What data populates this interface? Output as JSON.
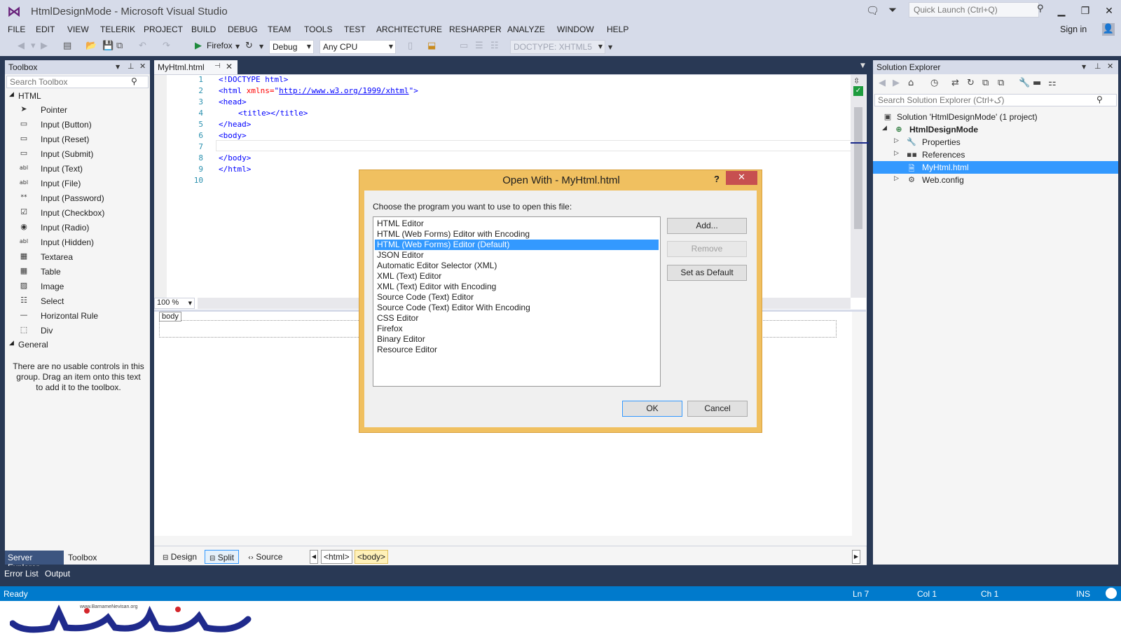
{
  "window": {
    "title": "HtmlDesignMode - Microsoft Visual Studio",
    "quick_launch_placeholder": "Quick Launch (Ctrl+Q)",
    "sign_in": "Sign in"
  },
  "menu": [
    "FILE",
    "EDIT",
    "VIEW",
    "TELERIK",
    "PROJECT",
    "BUILD",
    "DEBUG",
    "TEAM",
    "TOOLS",
    "TEST",
    "ARCHITECTURE",
    "RESHARPER",
    "ANALYZE",
    "WINDOW",
    "HELP"
  ],
  "toolbar": {
    "run_target": "Firefox",
    "configuration": "Debug",
    "platform": "Any CPU",
    "doctype": "DOCTYPE: XHTML5"
  },
  "toolbox": {
    "title": "Toolbox",
    "search_placeholder": "Search Toolbox",
    "group_html": "HTML",
    "items": [
      "Pointer",
      "Input (Button)",
      "Input (Reset)",
      "Input (Submit)",
      "Input (Text)",
      "Input (File)",
      "Input (Password)",
      "Input (Checkbox)",
      "Input (Radio)",
      "Input (Hidden)",
      "Textarea",
      "Table",
      "Image",
      "Select",
      "Horizontal Rule",
      "Div"
    ],
    "item_icons": [
      "pointer-icon",
      "button-icon",
      "reset-icon",
      "submit-icon",
      "textbox-icon",
      "file-icon",
      "password-icon",
      "checkbox-icon",
      "radio-icon",
      "hidden-icon",
      "textarea-icon",
      "table-icon",
      "image-icon",
      "select-icon",
      "horizontal-rule-icon",
      "div-icon"
    ],
    "group_general": "General",
    "general_empty": "There are no usable controls in this group. Drag an item onto this text to add it to the toolbox.",
    "tab_server_explorer": "Server Explorer",
    "tab_toolbox": "Toolbox"
  },
  "editor": {
    "tab_label": "MyHtml.html",
    "line_numbers": [
      "1",
      "2",
      "3",
      "4",
      "5",
      "6",
      "7",
      "8",
      "9",
      "10"
    ],
    "code": {
      "l1": "<!DOCTYPE html>",
      "l2_open": "<html ",
      "l2_attr": "xmlns=",
      "l2_q1": "\"",
      "l2_url": "http://www.w3.org/1999/xhtml",
      "l2_q2": "\"",
      "l2_close": ">",
      "l3": "<head>",
      "l4": "<title></title>",
      "l5": "</head>",
      "l6": "<body>",
      "l8": "</body>",
      "l9": "</html>"
    },
    "zoom": "100 %",
    "design_body_tag": "body",
    "views": [
      "Design",
      "Split",
      "Source"
    ],
    "breadcrumbs": [
      "<html>",
      "<body>"
    ]
  },
  "solution_explorer": {
    "title": "Solution Explorer",
    "search_placeholder": "Search Solution Explorer (Ctrl+ک)",
    "solution": "Solution 'HtmlDesignMode' (1 project)",
    "project": "HtmlDesignMode",
    "items": [
      "Properties",
      "References",
      "MyHtml.html",
      "Web.config"
    ]
  },
  "dialog": {
    "title": "Open With - MyHtml.html",
    "help": "?",
    "prompt": "Choose the program you want to use to open this file:",
    "programs": [
      "HTML Editor",
      "HTML (Web Forms) Editor with Encoding",
      "HTML (Web Forms) Editor (Default)",
      "JSON Editor",
      "Automatic Editor Selector (XML)",
      "XML (Text) Editor",
      "XML (Text) Editor with Encoding",
      "Source Code (Text) Editor",
      "Source Code (Text) Editor With Encoding",
      "CSS Editor",
      "Firefox",
      "Binary Editor",
      "Resource Editor"
    ],
    "selected_index": 2,
    "buttons": {
      "add": "Add...",
      "remove": "Remove",
      "set_default": "Set as Default",
      "ok": "OK",
      "cancel": "Cancel"
    }
  },
  "bottom_tabs": [
    "Error List",
    "Output"
  ],
  "status": {
    "ready": "Ready",
    "line": "Ln 7",
    "col": "Col 1",
    "ch": "Ch 1",
    "mode": "INS"
  },
  "watermark": {
    "site": "www.BarnameNevisan.org",
    "name": "برنامه نویسان"
  },
  "colors": {
    "accent": "#007acc",
    "selection": "#3399ff",
    "dialog_frame": "#f0c060",
    "chrome": "#d6dbe9"
  }
}
